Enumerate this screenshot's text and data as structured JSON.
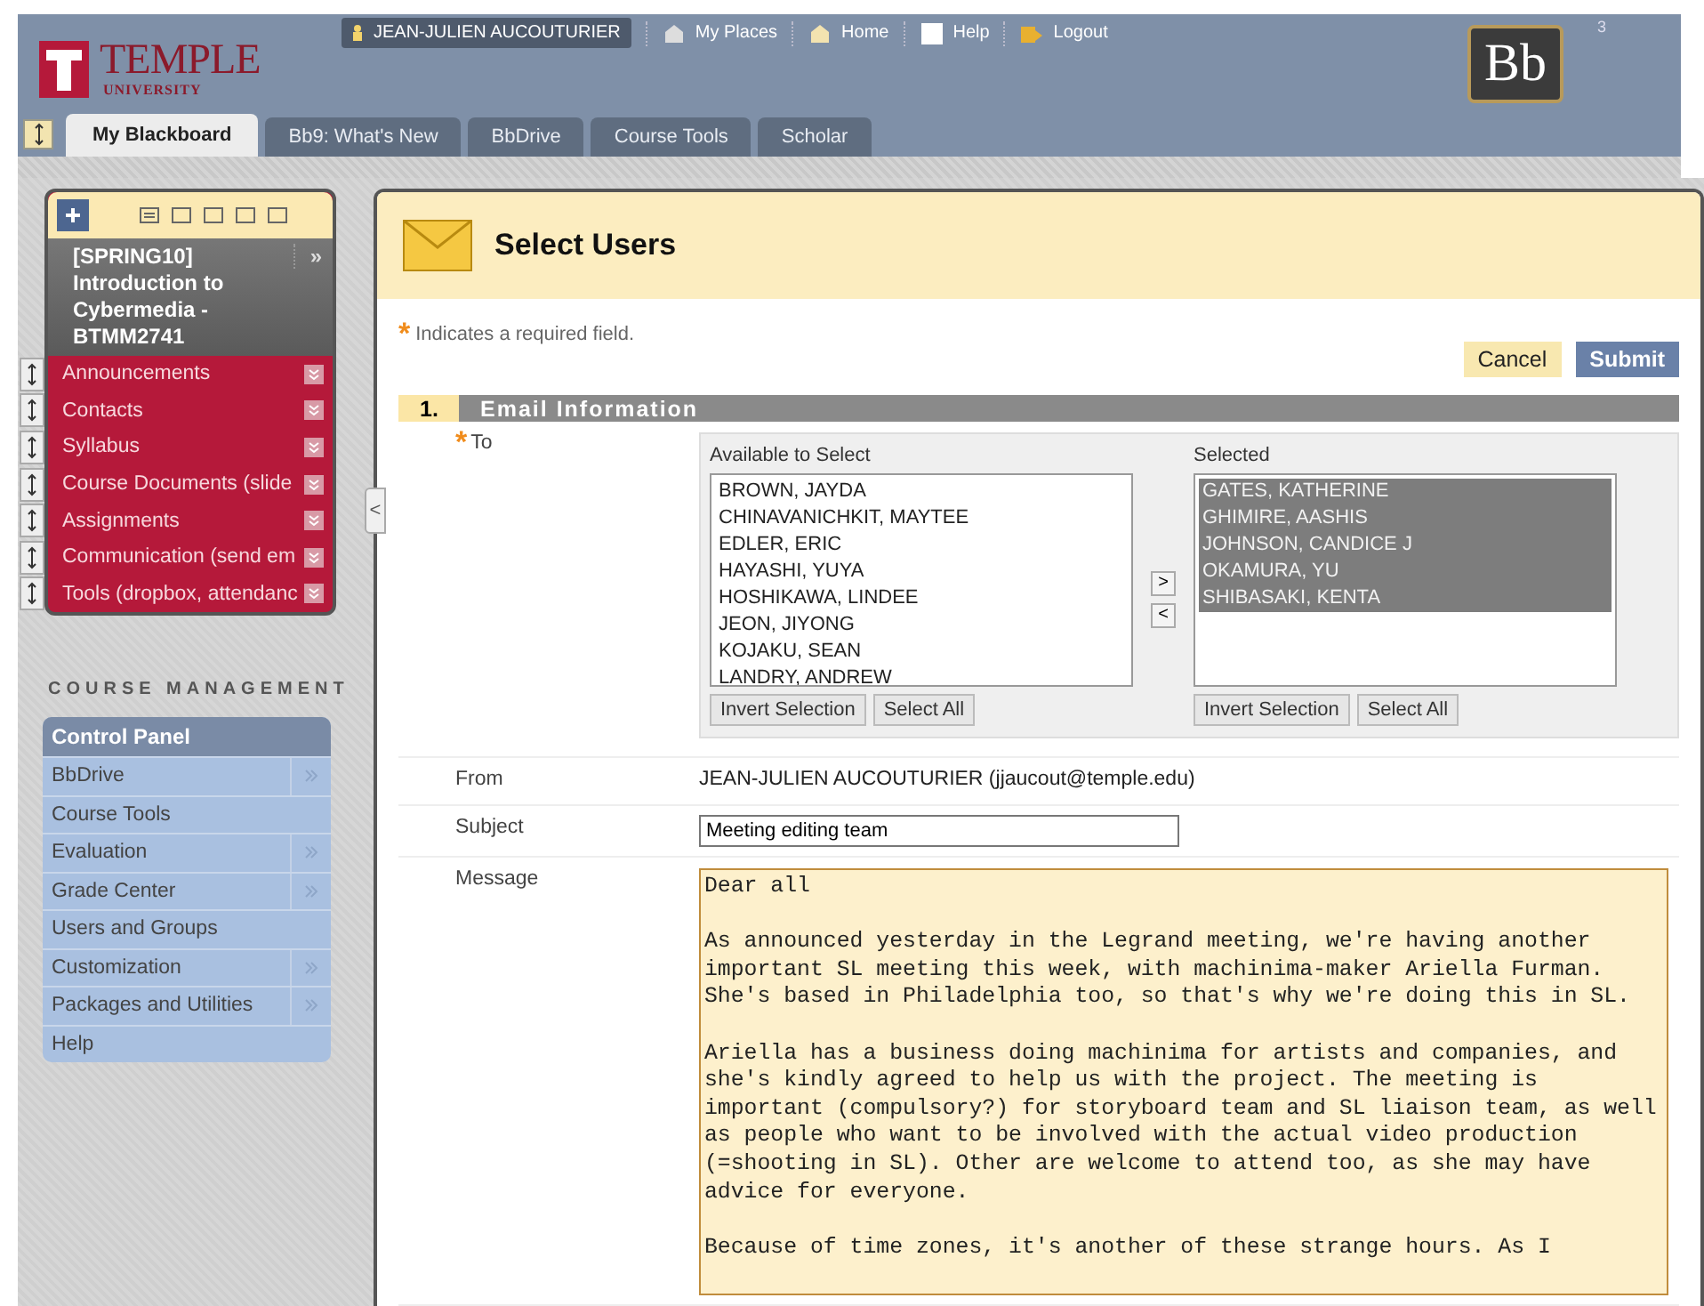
{
  "header": {
    "logo_name": "TEMPLE",
    "logo_sub": "UNIVERSITY",
    "user": "JEAN-JULIEN AUCOUTURIER",
    "nav_links": [
      "My Places",
      "Home",
      "Help",
      "Logout"
    ],
    "brand": "Bb",
    "badge": "3"
  },
  "tabs": [
    {
      "label": "My Blackboard",
      "selected": true
    },
    {
      "label": "Bb9: What's New",
      "selected": false
    },
    {
      "label": "BbDrive",
      "selected": false
    },
    {
      "label": "Course Tools",
      "selected": false
    },
    {
      "label": "Scholar",
      "selected": false
    }
  ],
  "course_menu": {
    "title": "[SPRING10] Introduction to Cybermedia - BTMM2741",
    "more": "»",
    "items": [
      "Announcements",
      "Contacts",
      "Syllabus",
      "Course Documents (slide",
      "Assignments",
      "Communication (send em",
      "Tools (dropbox, attendanc"
    ],
    "collapse": "<"
  },
  "course_management": {
    "heading": "COURSE MANAGEMENT",
    "title": "Control Panel",
    "items": [
      {
        "label": "BbDrive",
        "submenu": true
      },
      {
        "label": "Course Tools",
        "submenu": false
      },
      {
        "label": "Evaluation",
        "submenu": true
      },
      {
        "label": "Grade Center",
        "submenu": true
      },
      {
        "label": "Users and Groups",
        "submenu": false
      },
      {
        "label": "Customization",
        "submenu": true
      },
      {
        "label": "Packages and Utilities",
        "submenu": true
      },
      {
        "label": "Help",
        "submenu": false
      }
    ]
  },
  "page": {
    "title": "Select Users",
    "required_mark": "*",
    "required_note": "Indicates a required field.",
    "buttons": [
      {
        "kind": "secondary",
        "label": "Cancel"
      },
      {
        "kind": "primary",
        "label": "Submit"
      }
    ],
    "section": {
      "number": "1.",
      "title": "Email Information"
    },
    "to": {
      "label": "To",
      "required": true,
      "available": {
        "title": "Available to Select",
        "items": [
          {
            "name": "BROWN, JAYDA",
            "selected": false
          },
          {
            "name": "CHINAVANICHKIT, MAYTEE",
            "selected": false
          },
          {
            "name": "EDLER, ERIC",
            "selected": false
          },
          {
            "name": "HAYASHI, YUYA",
            "selected": false
          },
          {
            "name": "HOSHIKAWA, LINDEE",
            "selected": false
          },
          {
            "name": "JEON, JIYONG",
            "selected": false
          },
          {
            "name": "KOJAKU, SEAN",
            "selected": false
          },
          {
            "name": "LANDRY, ANDREW",
            "selected": false
          }
        ],
        "buttons": [
          "Invert Selection",
          "Select All"
        ]
      },
      "move_buttons": [
        ">",
        "<"
      ],
      "selected": {
        "title": "Selected",
        "items": [
          {
            "name": "GATES, KATHERINE",
            "selected": true
          },
          {
            "name": "GHIMIRE, AASHIS",
            "selected": true
          },
          {
            "name": "JOHNSON, CANDICE J",
            "selected": true
          },
          {
            "name": "OKAMURA, YU",
            "selected": true
          },
          {
            "name": "SHIBASAKI, KENTA",
            "selected": true
          }
        ],
        "buttons": [
          "Invert Selection",
          "Select All"
        ]
      }
    },
    "from": {
      "label": "From",
      "value": "JEAN-JULIEN AUCOUTURIER (jjaucout@temple.edu)"
    },
    "subject": {
      "label": "Subject",
      "value": "Meeting editing team"
    },
    "message": {
      "label": "Message",
      "value": "Dear all\n\nAs announced yesterday in the Legrand meeting, we're having another important SL meeting this week, with machinima-maker Ariella Furman. She's based in Philadelphia too, so that's why we're doing this in SL.\n\nAriella has a business doing machinima for artists and companies, and she's kindly agreed to help us with the project. The meeting is important (compulsory?) for storyboard team and SL liaison team, as well as people who want to be involved with the actual video production (=shooting in SL). Other are welcome to attend too, as she may have advice for everyone.\n\nBecause of time zones, it's another of these strange hours. As I"
    }
  }
}
